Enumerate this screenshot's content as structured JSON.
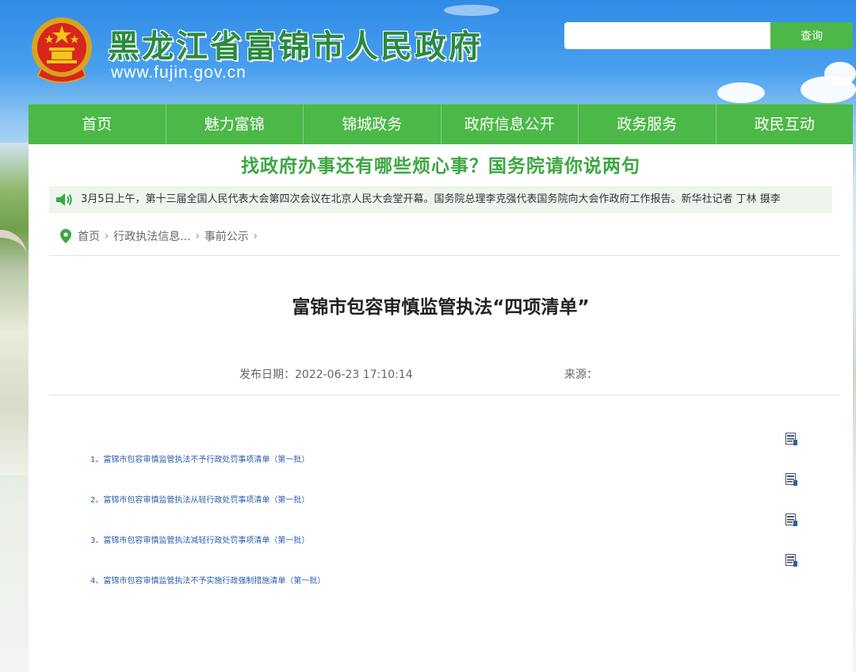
{
  "header": {
    "site_title": "黑龙江省富锦市人民政府",
    "site_domain": "www.fujin.gov.cn",
    "search": {
      "placeholder": "",
      "value": "",
      "button_label": "查询"
    }
  },
  "nav": {
    "items": [
      {
        "label": "首页"
      },
      {
        "label": "魅力富锦"
      },
      {
        "label": "锦城政务"
      },
      {
        "label": "政府信息公开"
      },
      {
        "label": "政务服务"
      },
      {
        "label": "政民互动"
      }
    ]
  },
  "banner": {
    "text": "找政府办事还有哪些烦心事？国务院请你说两句"
  },
  "ticker": {
    "text": "3月5日上午，第十三届全国人民代表大会第四次会议在北京人民大会堂开幕。国务院总理李克强代表国务院向大会作政府工作报告。新华社记者 丁林 摄李"
  },
  "breadcrumb": {
    "items": [
      {
        "label": "首页"
      },
      {
        "label": "行政执法信息..."
      },
      {
        "label": "事前公示"
      }
    ],
    "separator": "›"
  },
  "article": {
    "title": "富锦市包容审慎监管执法“四项清单”",
    "publish_date": "发布日期：2022-06-23 17:10:14",
    "source": "来源："
  },
  "attachments": [
    {
      "label": "1、富锦市包容审慎监管执法不予行政处罚事项清单（第一批）"
    },
    {
      "label": "2、富锦市包容审慎监管执法从轻行政处罚事项清单（第一批）"
    },
    {
      "label": "3、富锦市包容审慎监管执法减轻行政处罚事项清单（第一批）"
    },
    {
      "label": "4、富锦市包容审慎监管执法不予实施行政强制措施清单（第一批）"
    }
  ],
  "icons": {
    "emblem": "national-emblem-icon",
    "search_button": "search-button",
    "ticker": "speaker-icon",
    "breadcrumb": "location-pin-icon",
    "attachment": "document-icon"
  },
  "colors": {
    "nav_green": "#4cb848",
    "banner_green": "#3ba741",
    "title_green": "#2a8a3e",
    "link_blue": "#2c5ea8",
    "ticker_bg": "#eef5ee"
  }
}
